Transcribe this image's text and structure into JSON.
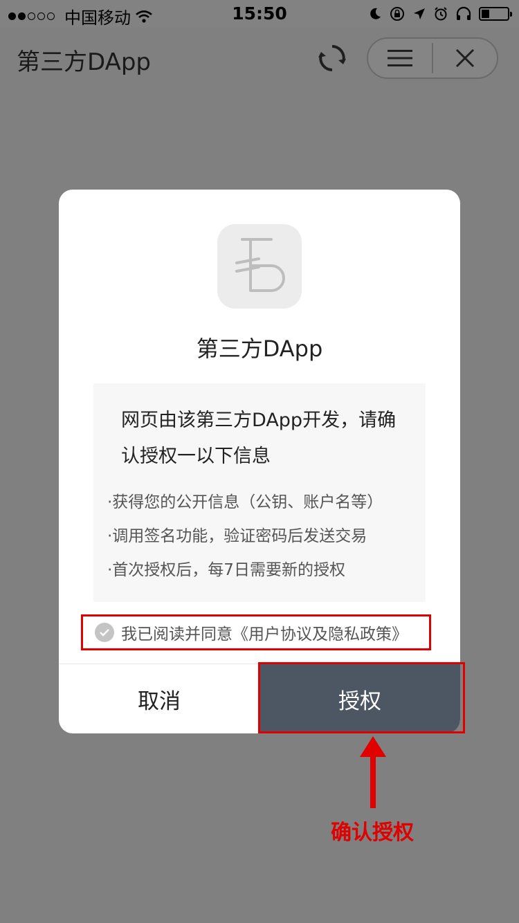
{
  "status_bar": {
    "carrier": "中国移动",
    "time": "15:50"
  },
  "nav": {
    "title": "第三方DApp"
  },
  "dialog": {
    "app_name": "第三方DApp",
    "description": "网页由该第三方DApp开发，请确认授权一以下信息",
    "items": [
      "·获得您的公开信息（公钥、账户名等）",
      "·调用签名功能，验证密码后发送交易",
      "·首次授权后，每7日需要新的授权"
    ],
    "agreement": "我已阅读并同意《用户协议及隐私政策》",
    "cancel_label": "取消",
    "authorize_label": "授权"
  },
  "annotation": {
    "label": "确认授权",
    "color": "#e00000"
  },
  "colors": {
    "overlay": "#808080",
    "authorize_button": "#4d5763",
    "highlight": "#e00000"
  }
}
